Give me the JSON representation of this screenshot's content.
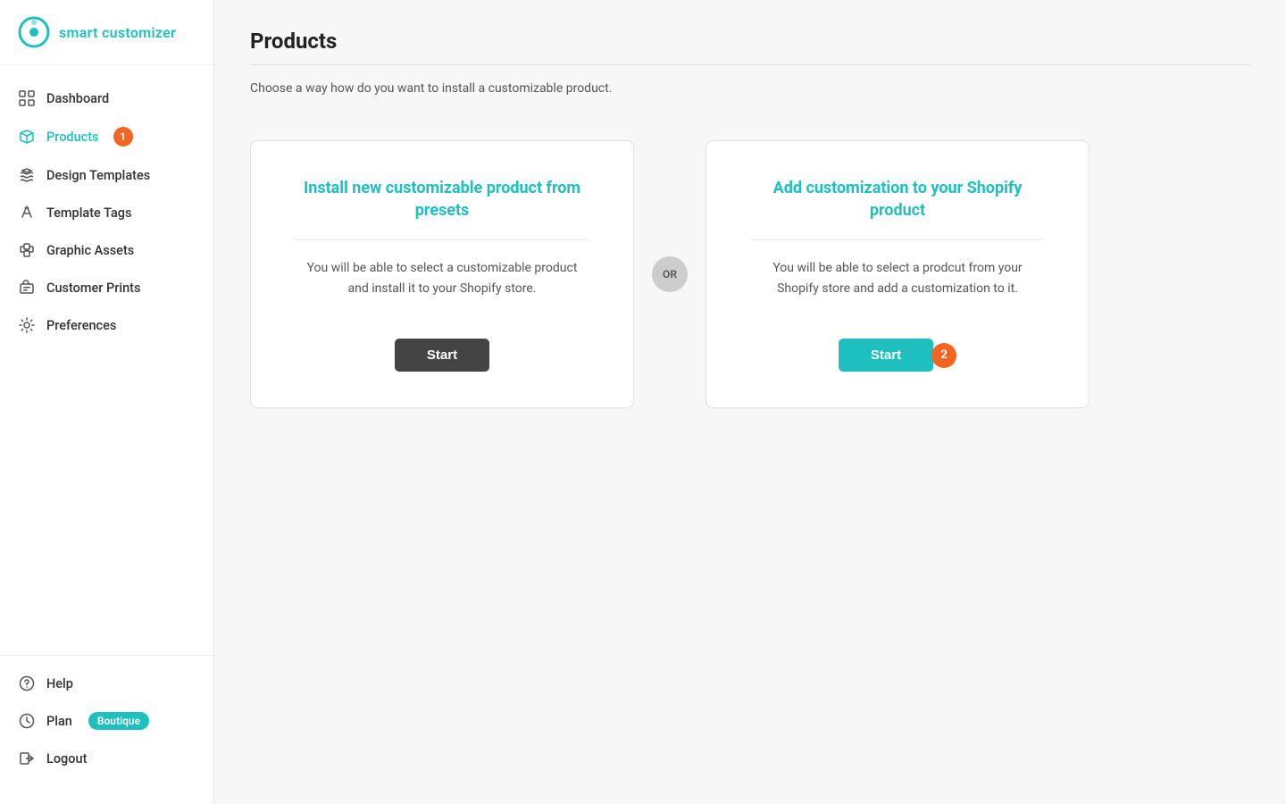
{
  "app": {
    "logo_text": "smart customizer",
    "logo_alt": "Smart Customizer Logo"
  },
  "sidebar": {
    "items": [
      {
        "id": "dashboard",
        "label": "Dashboard",
        "active": false,
        "badge": null
      },
      {
        "id": "products",
        "label": "Products",
        "active": true,
        "badge": "1"
      },
      {
        "id": "design-templates",
        "label": "Design Templates",
        "active": false,
        "badge": null
      },
      {
        "id": "template-tags",
        "label": "Template Tags",
        "active": false,
        "badge": null
      },
      {
        "id": "graphic-assets",
        "label": "Graphic Assets",
        "active": false,
        "badge": null
      },
      {
        "id": "customer-prints",
        "label": "Customer Prints",
        "active": false,
        "badge": null
      },
      {
        "id": "preferences",
        "label": "Preferences",
        "active": false,
        "badge": null
      }
    ],
    "bottom": [
      {
        "id": "help",
        "label": "Help"
      },
      {
        "id": "plan",
        "label": "Plan",
        "badge": "Boutique"
      },
      {
        "id": "logout",
        "label": "Logout"
      }
    ]
  },
  "main": {
    "title": "Products",
    "subtitle": "Choose a way how do you want to install a customizable product.",
    "card_left": {
      "title": "Install new customizable product from presets",
      "description": "You will be able to select a customizable product and install it to your Shopify store.",
      "button_label": "Start"
    },
    "or_label": "OR",
    "card_right": {
      "title": "Add customization to your Shopify product",
      "description": "You will be able to select a prodcut from your Shopify store and add a customization to it.",
      "button_label": "Start",
      "badge": "2"
    }
  }
}
